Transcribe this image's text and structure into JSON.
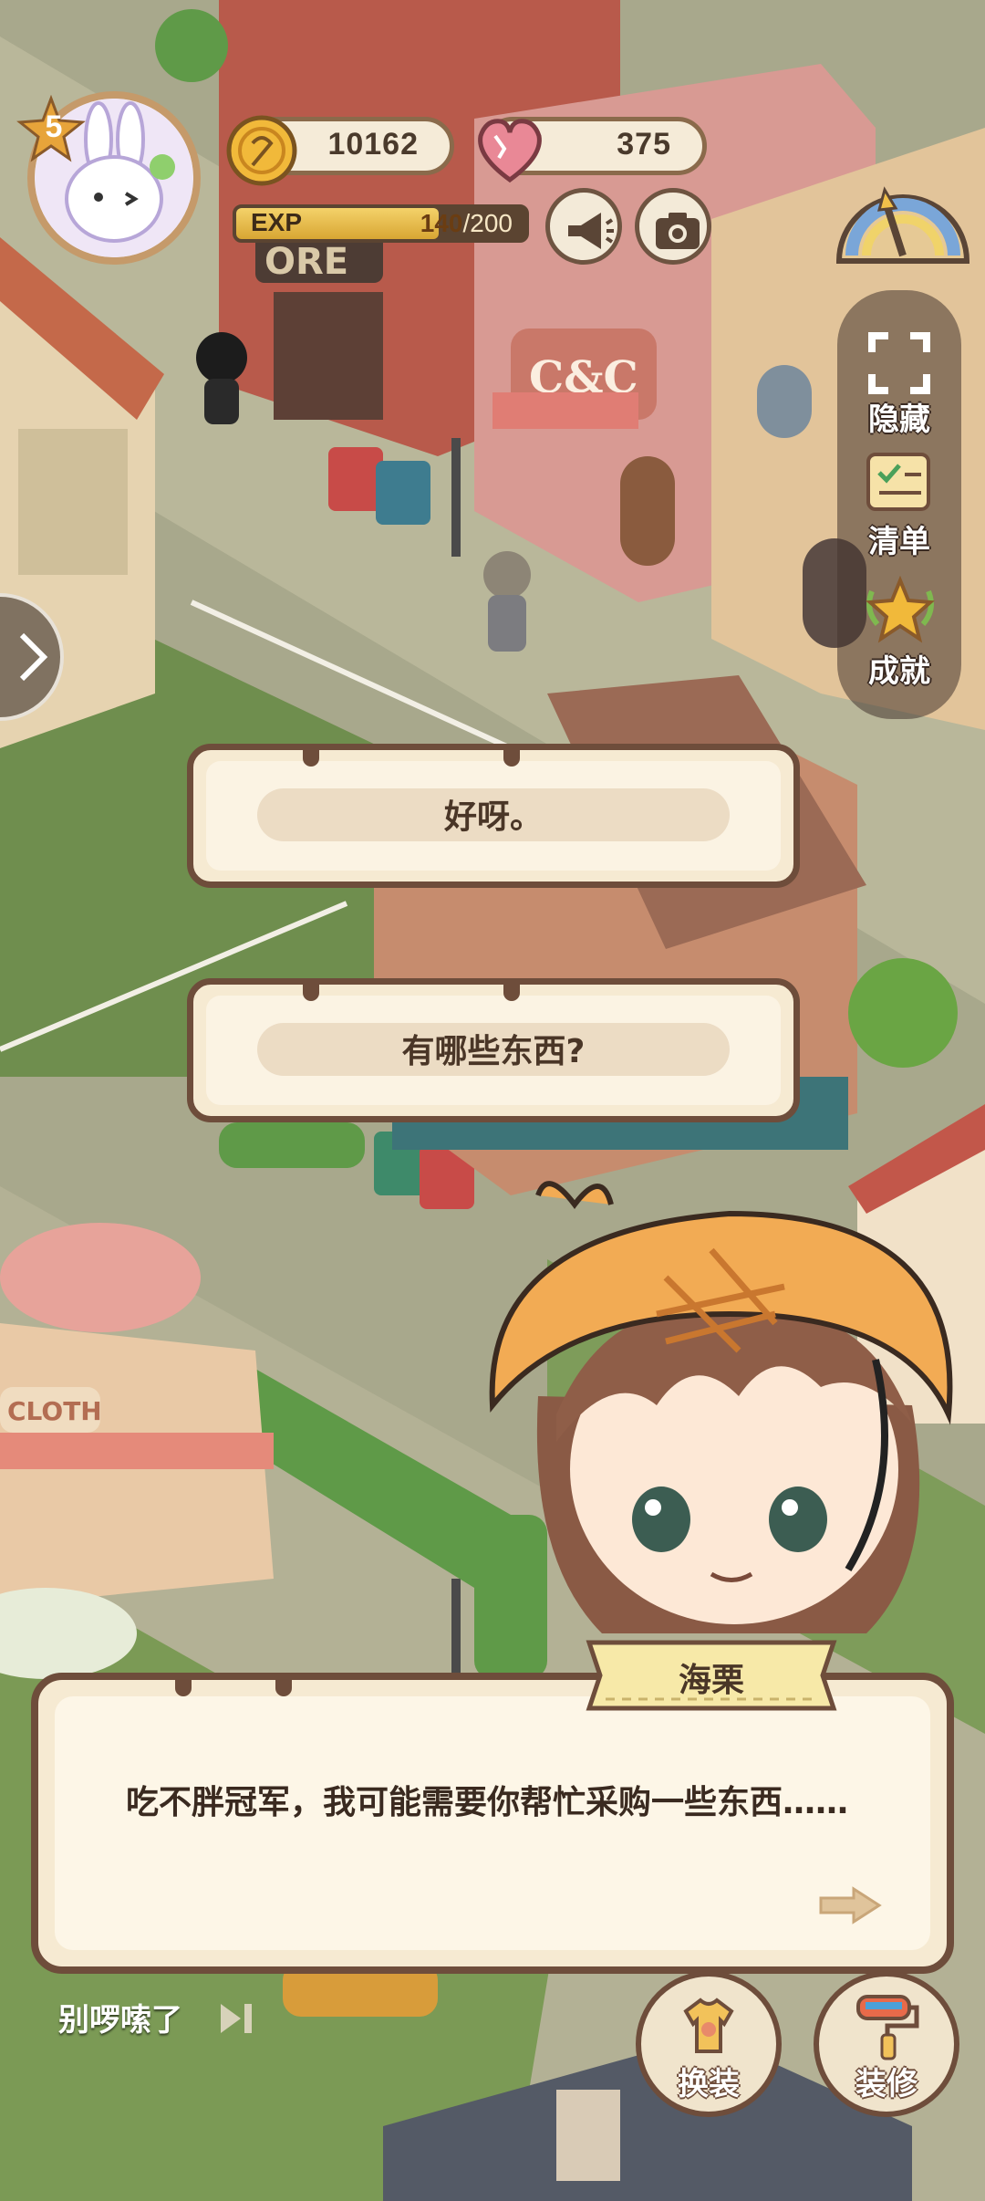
{
  "hud": {
    "level": "5",
    "coins": "10162",
    "hearts": "375",
    "exp_label": "EXP",
    "exp_current": "140",
    "exp_max": "/200",
    "exp_progress": 0.7
  },
  "side_menu": {
    "items": [
      {
        "label": "隐藏",
        "icon": "fullscreen-corners-icon"
      },
      {
        "label": "清单",
        "icon": "checklist-icon"
      },
      {
        "label": "成就",
        "icon": "star-trophy-icon"
      }
    ]
  },
  "scene": {
    "shop_sign": "C&C",
    "store_sign": "ORE",
    "cloth_sign": "CLOTH"
  },
  "choices": [
    {
      "text": "好呀。"
    },
    {
      "text": "有哪些东西?"
    }
  ],
  "dialog": {
    "speaker": "海栗",
    "text": "吃不胖冠军，我可能需要你帮忙采购一些东西……"
  },
  "controls": {
    "skip_label": "别啰嗦了",
    "outfit_label": "换装",
    "decorate_label": "装修"
  },
  "colors": {
    "panel_border": "#6e4d3b",
    "panel_fill": "#f6ead2",
    "grass": "#6f8e4e",
    "road": "#b9b79a"
  }
}
